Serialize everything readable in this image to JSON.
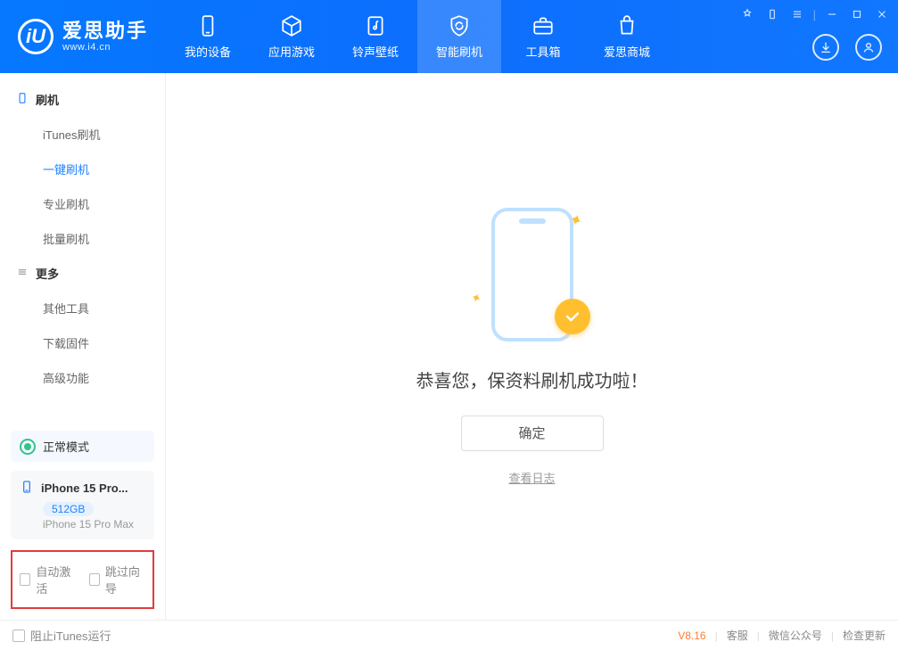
{
  "app": {
    "title": "爱思助手",
    "subtitle": "www.i4.cn"
  },
  "nav": {
    "items": [
      {
        "label": "我的设备",
        "icon": "phone"
      },
      {
        "label": "应用游戏",
        "icon": "cube"
      },
      {
        "label": "铃声壁纸",
        "icon": "music"
      },
      {
        "label": "智能刷机",
        "icon": "shield",
        "active": true
      },
      {
        "label": "工具箱",
        "icon": "toolbox"
      },
      {
        "label": "爱思商城",
        "icon": "bag"
      }
    ]
  },
  "sidebar": {
    "group1": {
      "title": "刷机",
      "items": [
        "iTunes刷机",
        "一键刷机",
        "专业刷机",
        "批量刷机"
      ],
      "active_index": 1
    },
    "group2": {
      "title": "更多",
      "items": [
        "其他工具",
        "下载固件",
        "高级功能"
      ]
    },
    "status_label": "正常模式",
    "device": {
      "name": "iPhone 15 Pro...",
      "storage": "512GB",
      "model": "iPhone 15 Pro Max"
    },
    "options": {
      "auto_activate": "自动激活",
      "skip_wizard": "跳过向导"
    }
  },
  "main": {
    "success_message": "恭喜您，保资料刷机成功啦！",
    "ok_label": "确定",
    "log_link": "查看日志"
  },
  "footer": {
    "block_itunes": "阻止iTunes运行",
    "version": "V8.16",
    "links": [
      "客服",
      "微信公众号",
      "检查更新"
    ]
  }
}
